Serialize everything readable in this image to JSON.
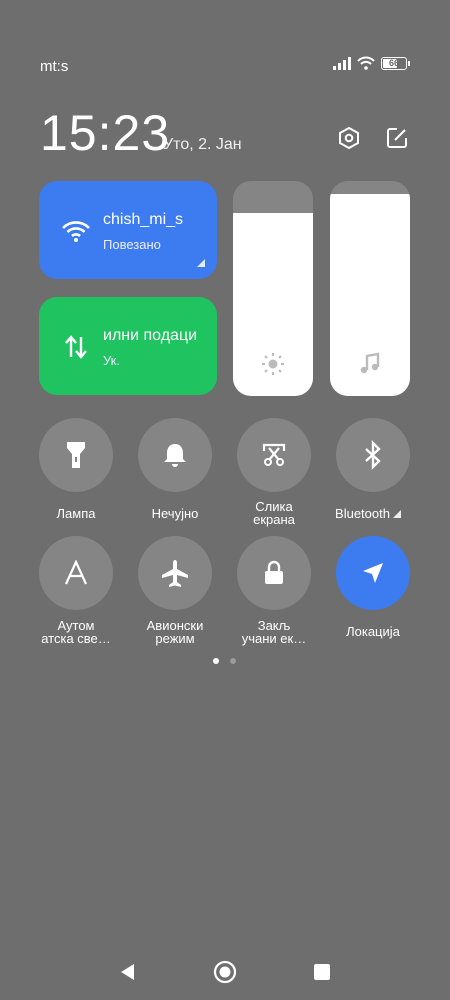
{
  "status_bar": {
    "carrier": "mt:s",
    "battery": "66"
  },
  "header": {
    "time": "15:23",
    "date": "Уто, 2. Јан"
  },
  "tiles": {
    "wifi": {
      "title": "chish_mi_s",
      "subtitle": "Повезано",
      "color": "#3d7cf0"
    },
    "data": {
      "title": "илни подаци",
      "subtitle": "Ук.",
      "color": "#1fc461"
    }
  },
  "sliders": {
    "brightness_level": 0.85,
    "volume_level": 0.94
  },
  "toggles": [
    {
      "label": "Лампа",
      "icon": "flashlight-icon",
      "active": false
    },
    {
      "label": "Нечујно",
      "icon": "bell-icon",
      "active": false
    },
    {
      "label": "Слика\nекрана",
      "icon": "scissors-icon",
      "active": false
    },
    {
      "label": "Bluetooth",
      "icon": "bluetooth-icon",
      "active": false
    },
    {
      "label": "Аутом\nатска све…",
      "icon": "auto-brightness-icon",
      "active": false
    },
    {
      "label": "Авионски\nрежим",
      "icon": "airplane-icon",
      "active": false
    },
    {
      "label": "Закљ\nучани ек…",
      "icon": "lock-icon",
      "active": false
    },
    {
      "label": "Локација",
      "icon": "location-icon",
      "active": true
    }
  ],
  "pager": {
    "current": 1,
    "total": 2
  },
  "nav": {
    "back": "back-icon",
    "home": "home-icon",
    "recents": "recents-icon"
  }
}
